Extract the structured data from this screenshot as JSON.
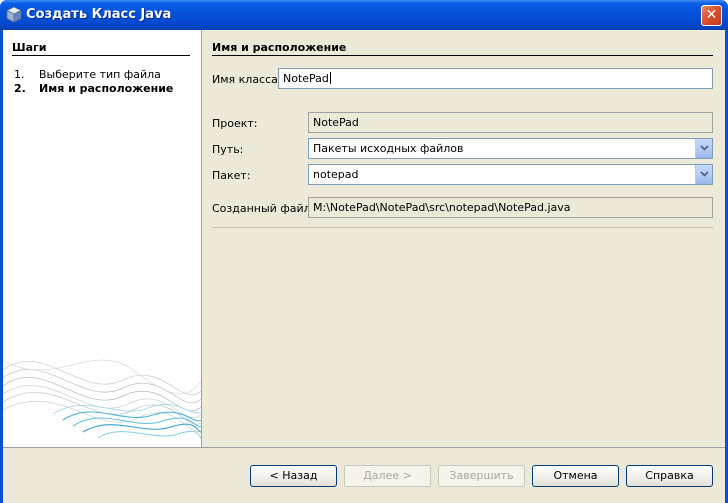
{
  "window": {
    "title": "Создать Класс Java",
    "close_label": "✕"
  },
  "steps": {
    "title": "Шаги",
    "items": [
      {
        "num": "1.",
        "label": "Выберите тип файла"
      },
      {
        "num": "2.",
        "label": "Имя и расположение"
      }
    ]
  },
  "section": {
    "title": "Имя и расположение"
  },
  "form": {
    "class_name_label": "Имя класса:",
    "class_name_value": "NotePad",
    "project_label": "Проект:",
    "project_value": "NotePad",
    "location_label": "Путь:",
    "location_value": "Пакеты исходных файлов",
    "package_label": "Пакет:",
    "package_value": "notepad",
    "created_file_label": "Созданный файл:",
    "created_file_value": "M:\\NotePad\\NotePad\\src\\notepad\\NotePad.java"
  },
  "buttons": {
    "back": "< Назад",
    "next": "Далее >",
    "finish": "Завершить",
    "cancel": "Отмена",
    "help": "Справка"
  },
  "colors": {
    "titlebar": "#0552d8",
    "dialog_bg": "#ece9d8",
    "accent_waves": "#4fb3d9"
  }
}
